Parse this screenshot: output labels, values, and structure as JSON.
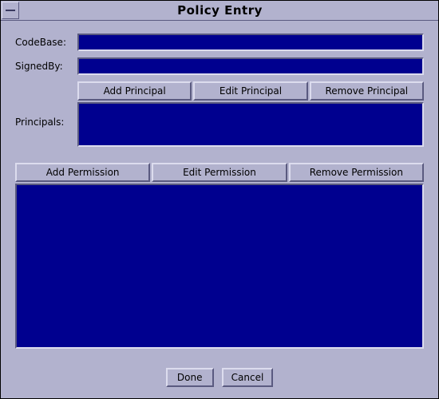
{
  "window": {
    "title": "Policy Entry"
  },
  "labels": {
    "codebase": "CodeBase:",
    "signedby": "SignedBy:",
    "principals": "Principals:"
  },
  "fields": {
    "codebase": "",
    "signedby": ""
  },
  "buttons": {
    "add_principal": "Add Principal",
    "edit_principal": "Edit Principal",
    "remove_principal": "Remove Principal",
    "add_permission": "Add Permission",
    "edit_permission": "Edit Permission",
    "remove_permission": "Remove Permission",
    "done": "Done",
    "cancel": "Cancel"
  }
}
